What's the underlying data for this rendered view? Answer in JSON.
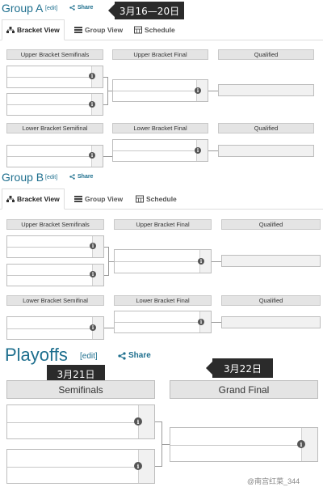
{
  "groupA": {
    "title": "Group A",
    "edit": "[edit]",
    "share": "Share",
    "callout": "3月16—20日"
  },
  "groupB": {
    "title": "Group B",
    "edit": "[edit]",
    "share": "Share"
  },
  "tabs": {
    "bracket": "Bracket View",
    "group": "Group View",
    "schedule": "Schedule"
  },
  "headers": {
    "ubs": "Upper Bracket Semifinals",
    "ubf": "Upper Bracket Final",
    "qual": "Qualified",
    "lbs": "Lower Bracket Semifinal",
    "lbf": "Lower Bracket Final"
  },
  "playoffs": {
    "title": "Playoffs",
    "edit": "[edit]",
    "share": "Share",
    "callout_semis": "3月21日",
    "callout_final": "3月22日",
    "semis": "Semifinals",
    "final": "Grand Final"
  },
  "watermark": "@南宫红菜_344"
}
